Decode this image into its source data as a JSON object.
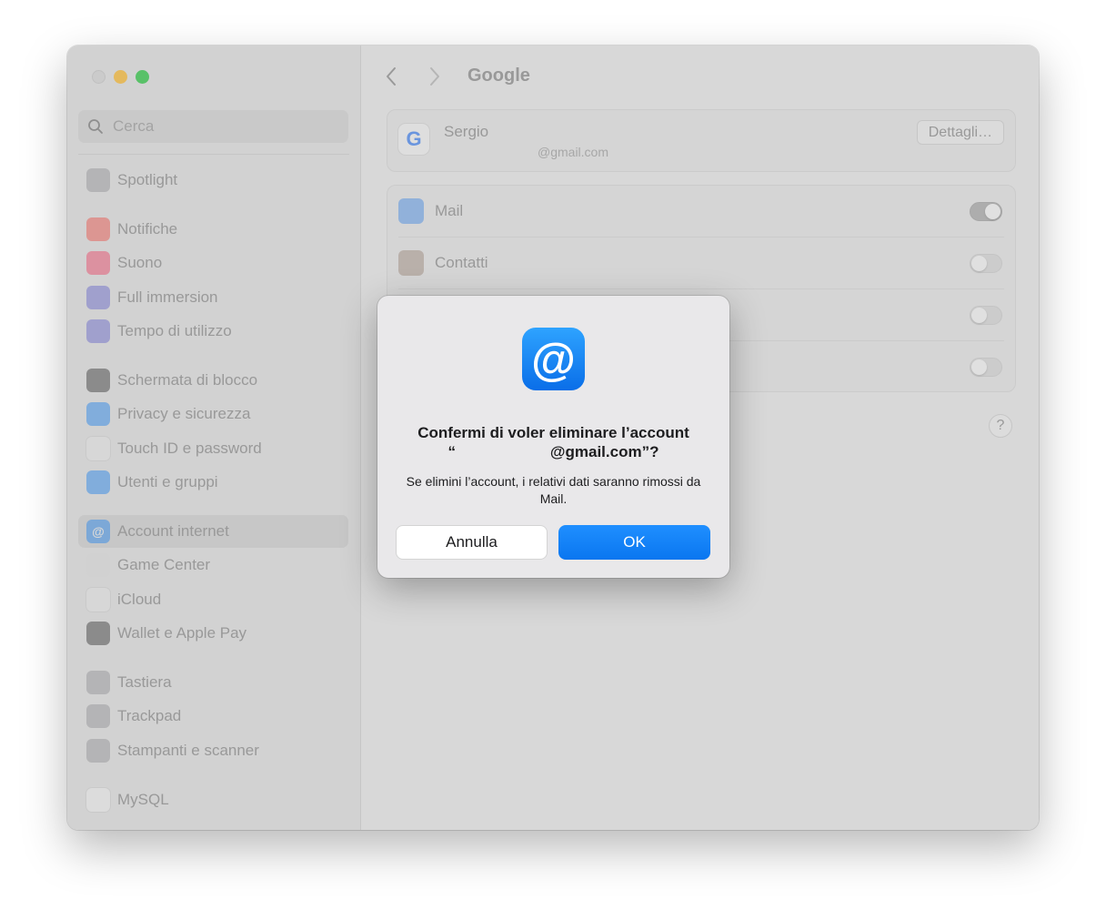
{
  "window": {
    "title": "Google"
  },
  "search": {
    "placeholder": "Cerca"
  },
  "sidebar": {
    "items": [
      {
        "label": "Spotlight",
        "icon": "magnifier-icon",
        "color": "#8e8e93"
      },
      {
        "label": "Notifiche",
        "icon": "bell-icon",
        "color": "#ff3b30"
      },
      {
        "label": "Suono",
        "icon": "speaker-icon",
        "color": "#ff2d55"
      },
      {
        "label": "Full immersion",
        "icon": "moon-icon",
        "color": "#5856d6"
      },
      {
        "label": "Tempo di utilizzo",
        "icon": "hourglass-icon",
        "color": "#5856d6"
      },
      {
        "label": "Schermata di blocco",
        "icon": "lock-icon",
        "color": "#1c1c1e"
      },
      {
        "label": "Privacy e sicurezza",
        "icon": "hand-icon",
        "color": "#007aff"
      },
      {
        "label": "Touch ID e password",
        "icon": "fingerprint-icon",
        "color": "#f2f2f2"
      },
      {
        "label": "Utenti e gruppi",
        "icon": "users-icon",
        "color": "#007aff"
      },
      {
        "label": "Account internet",
        "icon": "at-icon",
        "color": "#007aff",
        "selected": true
      },
      {
        "label": "Game Center",
        "icon": "game-center-icon",
        "color": "#e0e0e0"
      },
      {
        "label": "iCloud",
        "icon": "cloud-icon",
        "color": "#f2f2f2"
      },
      {
        "label": "Wallet e Apple Pay",
        "icon": "wallet-icon",
        "color": "#1c1c1e"
      },
      {
        "label": "Tastiera",
        "icon": "keyboard-icon",
        "color": "#8e8e93"
      },
      {
        "label": "Trackpad",
        "icon": "trackpad-icon",
        "color": "#8e8e93"
      },
      {
        "label": "Stampanti e scanner",
        "icon": "printer-icon",
        "color": "#8e8e93"
      },
      {
        "label": "MySQL",
        "icon": "mysql-icon",
        "color": "#ffffff"
      }
    ]
  },
  "account": {
    "name": "Sergio",
    "email": "@gmail.com",
    "details_label": "Dettagli…"
  },
  "services": [
    {
      "label": "Mail",
      "icon": "mail-icon",
      "enabled": true
    },
    {
      "label": "Contatti",
      "icon": "contacts-icon",
      "enabled": false
    },
    {
      "label": "",
      "enabled": false
    },
    {
      "label": "",
      "enabled": false
    }
  ],
  "help": {
    "label": "?"
  },
  "dialog": {
    "icon": "at-icon",
    "icon_glyph": "@",
    "title_line1": "Confermi di voler eliminare l’account",
    "title_line2": "“                      @gmail.com”?",
    "message": "Se elimini l’account, i relativi dati saranno rimossi da Mail.",
    "cancel_label": "Annulla",
    "ok_label": "OK"
  }
}
